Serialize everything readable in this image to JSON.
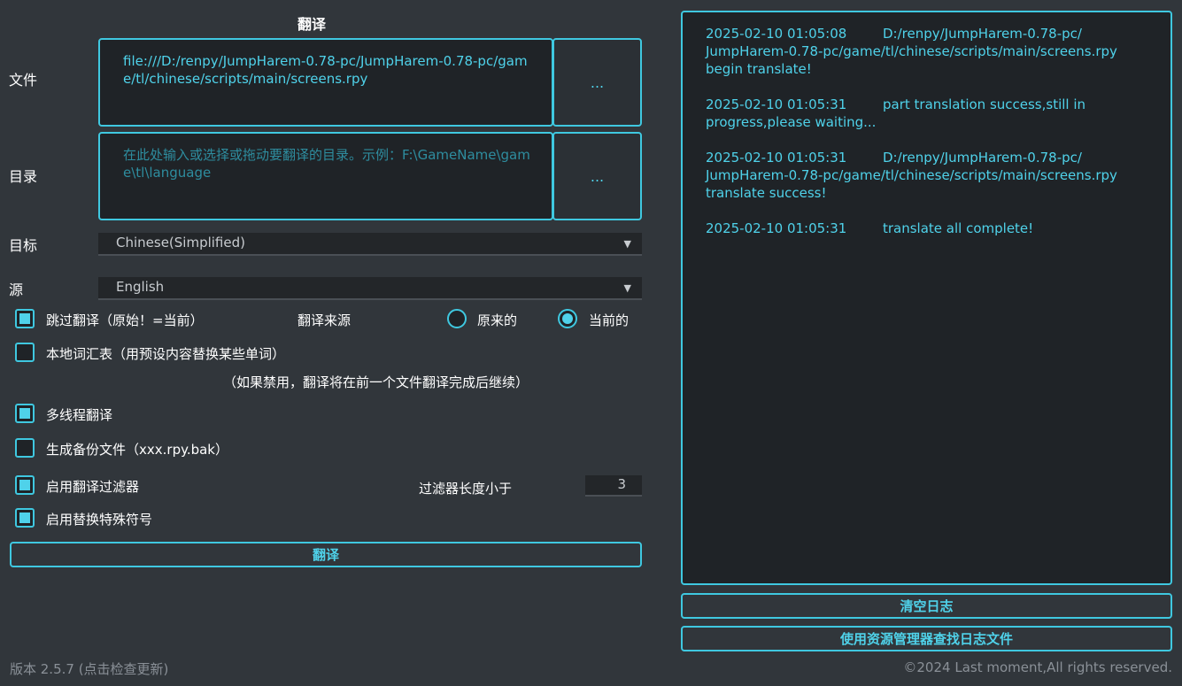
{
  "title": "翻译",
  "file": {
    "label": "文件",
    "value": "file:///D:/renpy/JumpHarem-0.78-pc/JumpHarem-0.78-pc/game/tl/chinese/scripts/main/screens.rpy",
    "browse": "..."
  },
  "directory": {
    "label": "目录",
    "placeholder": "在此处输入或选择或拖动要翻译的目录。示例：F:\\GameName\\game\\tl\\language",
    "browse": "..."
  },
  "target": {
    "label": "目标",
    "value": "Chinese(Simplified)"
  },
  "source": {
    "label": "源",
    "value": "English"
  },
  "skip_translated": {
    "label": "跳过翻译（原始！=当前）",
    "checked": true
  },
  "translate_source": {
    "label": "翻译来源",
    "original": "原来的",
    "current": "当前的",
    "selected": "current"
  },
  "local_glossary": {
    "label": "本地词汇表（用预设内容替换某些单词）",
    "checked": false
  },
  "note": "（如果禁用，翻译将在前一个文件翻译完成后继续）",
  "multithread": {
    "label": "多线程翻译",
    "checked": true
  },
  "backup": {
    "label": "生成备份文件（xxx.rpy.bak）",
    "checked": false
  },
  "filter": {
    "label": "启用翻译过滤器",
    "checked": true,
    "length_label": "过滤器长度小于",
    "length_value": "3"
  },
  "special_symbols": {
    "label": "启用替换特殊符号",
    "checked": true
  },
  "translate_button": "翻译",
  "log": [
    {
      "time": "2025-02-10 01:05:08",
      "line1": "D:/renpy/JumpHarem-0.78-pc/",
      "rest": "JumpHarem-0.78-pc/game/tl/chinese/scripts/main/screens.rpy begin translate!"
    },
    {
      "time": "2025-02-10 01:05:31",
      "line1": "part translation success,still in",
      "rest": "progress,please waiting..."
    },
    {
      "time": "2025-02-10 01:05:31",
      "line1": "D:/renpy/JumpHarem-0.78-pc/",
      "rest": "JumpHarem-0.78-pc/game/tl/chinese/scripts/main/screens.rpy translate success!"
    },
    {
      "time": "2025-02-10 01:05:31",
      "line1": "translate all complete!",
      "rest": ""
    }
  ],
  "clear_log_button": "清空日志",
  "open_log_button": "使用资源管理器查找日志文件",
  "version": "版本 2.5.7 (点击检查更新)",
  "copyright": "©2024 Last moment,All rights reserved.",
  "colors": {
    "accent": "#3fc8e0",
    "text_accent": "#4fd2ea",
    "background": "#31363b",
    "field": "#1f2327"
  }
}
